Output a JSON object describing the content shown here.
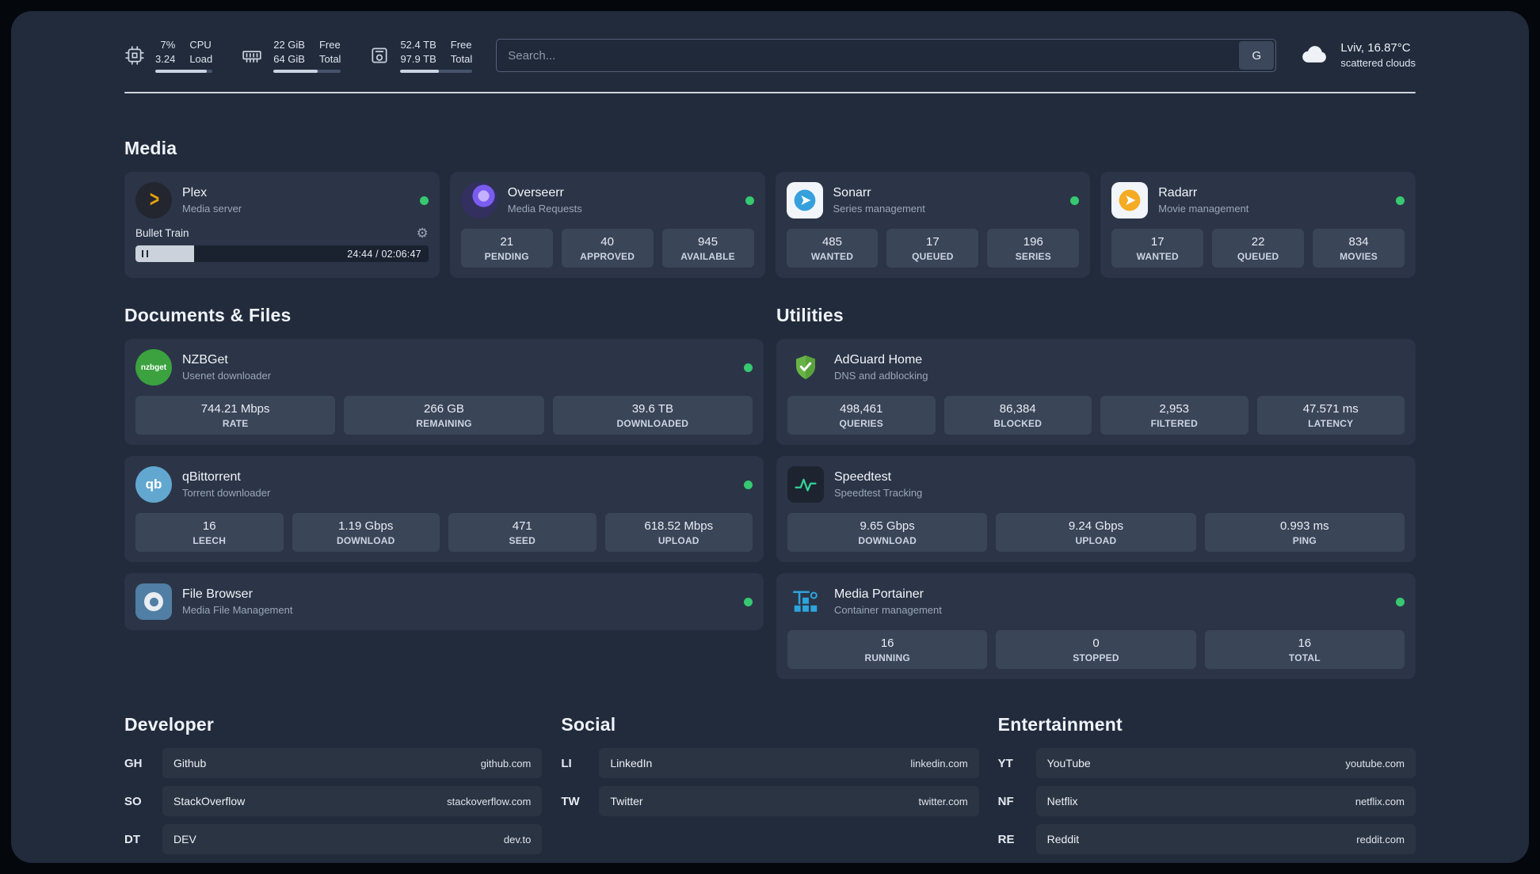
{
  "colors": {
    "status_online": "#37c871",
    "accent_amber": "#e5a00d",
    "page_bg": "#212b3c",
    "card_bg": "#2b3547",
    "tile_bg": "#3a4558"
  },
  "icons": {
    "gear": "⚙",
    "plex_chevron": ">",
    "nzbget_logo_text": "nzbget",
    "qbittorrent_logo_text": "qb"
  },
  "header": {
    "cpu": {
      "value1": "7%",
      "value2": "3.24",
      "label1": "CPU",
      "label2": "Load",
      "percent": 90
    },
    "ram": {
      "value1": "22 GiB",
      "value2": "64 GiB",
      "label1": "Free",
      "label2": "Total",
      "percent": 66
    },
    "disk": {
      "value1": "52.4 TB",
      "value2": "97.9 TB",
      "label1": "Free",
      "label2": "Total",
      "percent": 54
    },
    "search": {
      "placeholder": "Search...",
      "engine_label": "G"
    },
    "weather": {
      "location": "Lviv, 16.87°C",
      "condition": "scattered clouds"
    }
  },
  "sections": {
    "media": {
      "title": "Media",
      "apps": {
        "plex": {
          "name": "Plex",
          "subtitle": "Media server",
          "player": {
            "track": "Bullet Train",
            "time": "24:44 / 02:06:47",
            "progress": 20
          }
        },
        "overseerr": {
          "name": "Overseerr",
          "subtitle": "Media Requests",
          "stats": [
            {
              "value": "21",
              "label": "PENDING"
            },
            {
              "value": "40",
              "label": "APPROVED"
            },
            {
              "value": "945",
              "label": "AVAILABLE"
            }
          ]
        },
        "sonarr": {
          "name": "Sonarr",
          "subtitle": "Series management",
          "stats": [
            {
              "value": "485",
              "label": "WANTED"
            },
            {
              "value": "17",
              "label": "QUEUED"
            },
            {
              "value": "196",
              "label": "SERIES"
            }
          ]
        },
        "radarr": {
          "name": "Radarr",
          "subtitle": "Movie management",
          "stats": [
            {
              "value": "17",
              "label": "WANTED"
            },
            {
              "value": "22",
              "label": "QUEUED"
            },
            {
              "value": "834",
              "label": "MOVIES"
            }
          ]
        }
      }
    },
    "documents": {
      "title": "Documents & Files",
      "apps": {
        "nzbget": {
          "name": "NZBGet",
          "subtitle": "Usenet downloader",
          "stats": [
            {
              "value": "744.21 Mbps",
              "label": "RATE"
            },
            {
              "value": "266 GB",
              "label": "REMAINING"
            },
            {
              "value": "39.6 TB",
              "label": "DOWNLOADED"
            }
          ]
        },
        "qbittorrent": {
          "name": "qBittorrent",
          "subtitle": "Torrent downloader",
          "stats": [
            {
              "value": "16",
              "label": "LEECH"
            },
            {
              "value": "1.19 Gbps",
              "label": "DOWNLOAD"
            },
            {
              "value": "471",
              "label": "SEED"
            },
            {
              "value": "618.52 Mbps",
              "label": "UPLOAD"
            }
          ]
        },
        "filebrowser": {
          "name": "File Browser",
          "subtitle": "Media File Management"
        }
      }
    },
    "utilities": {
      "title": "Utilities",
      "apps": {
        "adguard": {
          "name": "AdGuard Home",
          "subtitle": "DNS and adblocking",
          "stats": [
            {
              "value": "498,461",
              "label": "QUERIES"
            },
            {
              "value": "86,384",
              "label": "BLOCKED"
            },
            {
              "value": "2,953",
              "label": "FILTERED"
            },
            {
              "value": "47.571 ms",
              "label": "LATENCY"
            }
          ]
        },
        "speedtest": {
          "name": "Speedtest",
          "subtitle": "Speedtest Tracking",
          "stats": [
            {
              "value": "9.65 Gbps",
              "label": "DOWNLOAD"
            },
            {
              "value": "9.24 Gbps",
              "label": "UPLOAD"
            },
            {
              "value": "0.993 ms",
              "label": "PING"
            }
          ]
        },
        "portainer": {
          "name": "Media Portainer",
          "subtitle": "Container management",
          "stats": [
            {
              "value": "16",
              "label": "RUNNING"
            },
            {
              "value": "0",
              "label": "STOPPED"
            },
            {
              "value": "16",
              "label": "TOTAL"
            }
          ]
        }
      }
    }
  },
  "bookmarks": {
    "developer": {
      "title": "Developer",
      "items": [
        {
          "code": "GH",
          "name": "Github",
          "url": "github.com"
        },
        {
          "code": "SO",
          "name": "StackOverflow",
          "url": "stackoverflow.com"
        },
        {
          "code": "DT",
          "name": "DEV",
          "url": "dev.to"
        }
      ]
    },
    "social": {
      "title": "Social",
      "items": [
        {
          "code": "LI",
          "name": "LinkedIn",
          "url": "linkedin.com"
        },
        {
          "code": "TW",
          "name": "Twitter",
          "url": "twitter.com"
        }
      ]
    },
    "entertainment": {
      "title": "Entertainment",
      "items": [
        {
          "code": "YT",
          "name": "YouTube",
          "url": "youtube.com"
        },
        {
          "code": "NF",
          "name": "Netflix",
          "url": "netflix.com"
        },
        {
          "code": "RE",
          "name": "Reddit",
          "url": "reddit.com"
        }
      ]
    }
  }
}
